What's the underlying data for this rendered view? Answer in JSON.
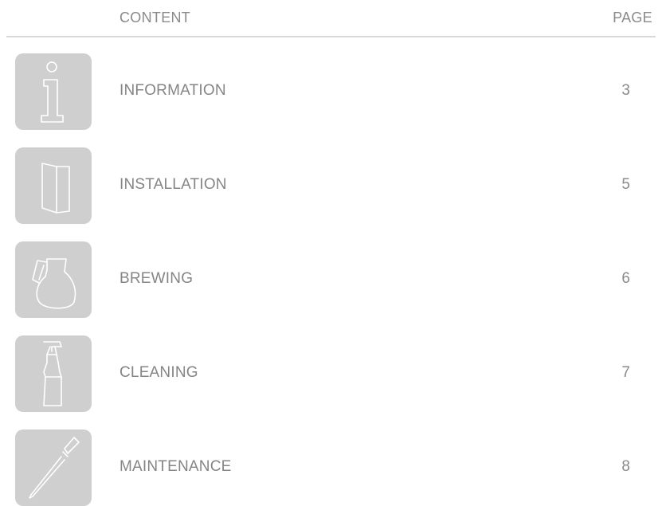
{
  "header": {
    "content_label": "CONTENT",
    "page_label": "PAGE"
  },
  "colors": {
    "tile_bg": "#cfcfcf",
    "icon_stroke": "#ffffff",
    "text": "#858585",
    "rule": "#d9d9d9"
  },
  "entries": [
    {
      "label": "INFORMATION",
      "page": "3",
      "icon": "info-icon"
    },
    {
      "label": "INSTALLATION",
      "page": "5",
      "icon": "folded-document-icon"
    },
    {
      "label": "BREWING",
      "page": "6",
      "icon": "coffee-carafe-icon"
    },
    {
      "label": "CLEANING",
      "page": "7",
      "icon": "spray-bottle-icon"
    },
    {
      "label": "MAINTENANCE",
      "page": "8",
      "icon": "screwdriver-icon"
    }
  ]
}
